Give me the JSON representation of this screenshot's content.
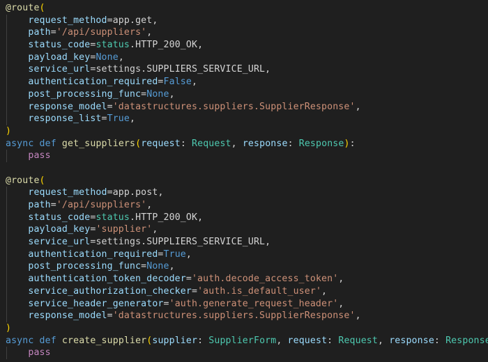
{
  "editor": {
    "language": "python",
    "background": "#1f1f1f",
    "colors": {
      "plain": "#d4d4d4",
      "param": "#9cdcfe",
      "string": "#ce9178",
      "const": "#569cd6",
      "keyword": "#569cd6",
      "control": "#c586c0",
      "func": "#dcdcaa",
      "class": "#4ec9b0",
      "deco": "#dcdcaa",
      "bracket": "#ffd700"
    },
    "lines": [
      {
        "indent": 0,
        "tokens": [
          {
            "t": "@route",
            "c": "deco"
          },
          {
            "t": "(",
            "c": "bracket"
          }
        ]
      },
      {
        "indent": 1,
        "tokens": [
          {
            "t": "request_method",
            "c": "param"
          },
          {
            "t": "=",
            "c": "plain"
          },
          {
            "t": "app.get",
            "c": "plain"
          },
          {
            "t": ",",
            "c": "plain"
          }
        ]
      },
      {
        "indent": 1,
        "tokens": [
          {
            "t": "path",
            "c": "param"
          },
          {
            "t": "=",
            "c": "plain"
          },
          {
            "t": "'/api/suppliers'",
            "c": "string"
          },
          {
            "t": ",",
            "c": "plain"
          }
        ]
      },
      {
        "indent": 1,
        "tokens": [
          {
            "t": "status_code",
            "c": "param"
          },
          {
            "t": "=",
            "c": "plain"
          },
          {
            "t": "status",
            "c": "class"
          },
          {
            "t": ".HTTP_200_OK,",
            "c": "plain"
          }
        ]
      },
      {
        "indent": 1,
        "tokens": [
          {
            "t": "payload_key",
            "c": "param"
          },
          {
            "t": "=",
            "c": "plain"
          },
          {
            "t": "None",
            "c": "const"
          },
          {
            "t": ",",
            "c": "plain"
          }
        ]
      },
      {
        "indent": 1,
        "tokens": [
          {
            "t": "service_url",
            "c": "param"
          },
          {
            "t": "=",
            "c": "plain"
          },
          {
            "t": "settings.SUPPLIERS_SERVICE_URL,",
            "c": "plain"
          }
        ]
      },
      {
        "indent": 1,
        "tokens": [
          {
            "t": "authentication_required",
            "c": "param"
          },
          {
            "t": "=",
            "c": "plain"
          },
          {
            "t": "False",
            "c": "const"
          },
          {
            "t": ",",
            "c": "plain"
          }
        ]
      },
      {
        "indent": 1,
        "tokens": [
          {
            "t": "post_processing_func",
            "c": "param"
          },
          {
            "t": "=",
            "c": "plain"
          },
          {
            "t": "None",
            "c": "const"
          },
          {
            "t": ",",
            "c": "plain"
          }
        ]
      },
      {
        "indent": 1,
        "tokens": [
          {
            "t": "response_model",
            "c": "param"
          },
          {
            "t": "=",
            "c": "plain"
          },
          {
            "t": "'datastructures.suppliers.SupplierResponse'",
            "c": "string"
          },
          {
            "t": ",",
            "c": "plain"
          }
        ]
      },
      {
        "indent": 1,
        "tokens": [
          {
            "t": "response_list",
            "c": "param"
          },
          {
            "t": "=",
            "c": "plain"
          },
          {
            "t": "True",
            "c": "const"
          },
          {
            "t": ",",
            "c": "plain"
          }
        ]
      },
      {
        "indent": 0,
        "tokens": [
          {
            "t": ")",
            "c": "bracket"
          }
        ]
      },
      {
        "indent": 0,
        "tokens": [
          {
            "t": "async",
            "c": "keyword"
          },
          {
            "t": " ",
            "c": "plain"
          },
          {
            "t": "def",
            "c": "keyword"
          },
          {
            "t": " ",
            "c": "plain"
          },
          {
            "t": "get_suppliers",
            "c": "func"
          },
          {
            "t": "(",
            "c": "bracket"
          },
          {
            "t": "request",
            "c": "param"
          },
          {
            "t": ": ",
            "c": "plain"
          },
          {
            "t": "Request",
            "c": "class"
          },
          {
            "t": ", ",
            "c": "plain"
          },
          {
            "t": "response",
            "c": "param"
          },
          {
            "t": ": ",
            "c": "plain"
          },
          {
            "t": "Response",
            "c": "class"
          },
          {
            "t": ")",
            "c": "bracket"
          },
          {
            "t": ":",
            "c": "plain"
          }
        ]
      },
      {
        "indent": 1,
        "tokens": [
          {
            "t": "pass",
            "c": "control"
          }
        ]
      },
      {
        "indent": 0,
        "tokens": []
      },
      {
        "indent": 0,
        "tokens": [
          {
            "t": "@route",
            "c": "deco"
          },
          {
            "t": "(",
            "c": "bracket"
          }
        ]
      },
      {
        "indent": 1,
        "tokens": [
          {
            "t": "request_method",
            "c": "param"
          },
          {
            "t": "=",
            "c": "plain"
          },
          {
            "t": "app.post",
            "c": "plain"
          },
          {
            "t": ",",
            "c": "plain"
          }
        ]
      },
      {
        "indent": 1,
        "tokens": [
          {
            "t": "path",
            "c": "param"
          },
          {
            "t": "=",
            "c": "plain"
          },
          {
            "t": "'/api/suppliers'",
            "c": "string"
          },
          {
            "t": ",",
            "c": "plain"
          }
        ]
      },
      {
        "indent": 1,
        "tokens": [
          {
            "t": "status_code",
            "c": "param"
          },
          {
            "t": "=",
            "c": "plain"
          },
          {
            "t": "status",
            "c": "class"
          },
          {
            "t": ".HTTP_200_OK,",
            "c": "plain"
          }
        ]
      },
      {
        "indent": 1,
        "tokens": [
          {
            "t": "payload_key",
            "c": "param"
          },
          {
            "t": "=",
            "c": "plain"
          },
          {
            "t": "'supplier'",
            "c": "string"
          },
          {
            "t": ",",
            "c": "plain"
          }
        ]
      },
      {
        "indent": 1,
        "tokens": [
          {
            "t": "service_url",
            "c": "param"
          },
          {
            "t": "=",
            "c": "plain"
          },
          {
            "t": "settings.SUPPLIERS_SERVICE_URL,",
            "c": "plain"
          }
        ]
      },
      {
        "indent": 1,
        "tokens": [
          {
            "t": "authentication_required",
            "c": "param"
          },
          {
            "t": "=",
            "c": "plain"
          },
          {
            "t": "True",
            "c": "const"
          },
          {
            "t": ",",
            "c": "plain"
          }
        ]
      },
      {
        "indent": 1,
        "tokens": [
          {
            "t": "post_processing_func",
            "c": "param"
          },
          {
            "t": "=",
            "c": "plain"
          },
          {
            "t": "None",
            "c": "const"
          },
          {
            "t": ",",
            "c": "plain"
          }
        ]
      },
      {
        "indent": 1,
        "tokens": [
          {
            "t": "authentication_token_decoder",
            "c": "param"
          },
          {
            "t": "=",
            "c": "plain"
          },
          {
            "t": "'auth.decode_access_token'",
            "c": "string"
          },
          {
            "t": ",",
            "c": "plain"
          }
        ]
      },
      {
        "indent": 1,
        "tokens": [
          {
            "t": "service_authorization_checker",
            "c": "param"
          },
          {
            "t": "=",
            "c": "plain"
          },
          {
            "t": "'auth.is_default_user'",
            "c": "string"
          },
          {
            "t": ",",
            "c": "plain"
          }
        ]
      },
      {
        "indent": 1,
        "tokens": [
          {
            "t": "service_header_generator",
            "c": "param"
          },
          {
            "t": "=",
            "c": "plain"
          },
          {
            "t": "'auth.generate_request_header'",
            "c": "string"
          },
          {
            "t": ",",
            "c": "plain"
          }
        ]
      },
      {
        "indent": 1,
        "tokens": [
          {
            "t": "response_model",
            "c": "param"
          },
          {
            "t": "=",
            "c": "plain"
          },
          {
            "t": "'datastructures.suppliers.SupplierResponse'",
            "c": "string"
          },
          {
            "t": ",",
            "c": "plain"
          }
        ]
      },
      {
        "indent": 0,
        "tokens": [
          {
            "t": ")",
            "c": "bracket"
          }
        ]
      },
      {
        "indent": 0,
        "tokens": [
          {
            "t": "async",
            "c": "keyword"
          },
          {
            "t": " ",
            "c": "plain"
          },
          {
            "t": "def",
            "c": "keyword"
          },
          {
            "t": " ",
            "c": "plain"
          },
          {
            "t": "create_supplier",
            "c": "func"
          },
          {
            "t": "(",
            "c": "bracket"
          },
          {
            "t": "supplier",
            "c": "param"
          },
          {
            "t": ": ",
            "c": "plain"
          },
          {
            "t": "SupplierForm",
            "c": "class"
          },
          {
            "t": ", ",
            "c": "plain"
          },
          {
            "t": "request",
            "c": "param"
          },
          {
            "t": ": ",
            "c": "plain"
          },
          {
            "t": "Request",
            "c": "class"
          },
          {
            "t": ", ",
            "c": "plain"
          },
          {
            "t": "response",
            "c": "param"
          },
          {
            "t": ": ",
            "c": "plain"
          },
          {
            "t": "Response",
            "c": "class"
          },
          {
            "t": ")",
            "c": "bracket"
          },
          {
            "t": ":",
            "c": "plain"
          }
        ]
      },
      {
        "indent": 1,
        "tokens": [
          {
            "t": "pass",
            "c": "control"
          }
        ]
      }
    ]
  }
}
